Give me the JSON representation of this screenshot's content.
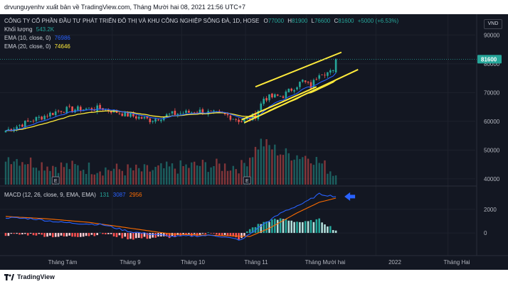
{
  "header": {
    "publisher_text": "drvunguyenhv xuất bản về TradingView.com, Tháng Mười hai 08, 2021 21:56 UTC+7"
  },
  "legend": {
    "symbol_line": "CÔNG TY CỔ PHẦN ĐẦU TƯ PHÁT TRIỂN ĐÔ THỊ VÀ KHU CÔNG NGHIỆP SÔNG ĐÀ, 1D, HOSE",
    "ohlc": {
      "o_label": "O",
      "o": "77000",
      "h_label": "H",
      "h": "81900",
      "l_label": "L",
      "l": "76600",
      "c_label": "C",
      "c": "81600",
      "change": "+5000 (+6.53%)"
    },
    "volume_label": "Khối lượng",
    "volume_value": "543.2K",
    "ema10_label": "EMA (10, close, 0)",
    "ema10_value": "76986",
    "ema20_label": "EMA (20, close, 0)",
    "ema20_value": "74646",
    "macd_label": "MACD (12, 26, close, 9, EMA, EMA)",
    "macd_hist": "131",
    "macd_line": "3087",
    "macd_signal": "2956",
    "currency": "VND"
  },
  "price_axis": {
    "ticks": [
      "90000",
      "80000",
      "70000",
      "60000",
      "50000",
      "40000"
    ],
    "last_price_label": "81600"
  },
  "macd_axis": {
    "ticks": [
      "2000",
      "0"
    ]
  },
  "time_axis": {
    "labels": [
      "Tháng Tám",
      "Tháng 9",
      "Tháng 10",
      "Tháng 11",
      "Tháng Mười hai",
      "2022",
      "Tháng Hai"
    ]
  },
  "earnings_marker": "E",
  "footer": {
    "brand": "TradingView"
  },
  "colors": {
    "background": "#131722",
    "up": "#26a69a",
    "down": "#ef5350",
    "ema10": "#2962ff",
    "ema20": "#ffeb3b",
    "macd_line": "#2962ff",
    "signal_line": "#ff6d00",
    "channel": "#ffeb3b",
    "arrow": "#2962ff"
  },
  "chart_data": {
    "type": "candlestick",
    "instrument": "CÔNG TY CỔ PHẦN ĐẦU TƯ PHÁT TRIỂN ĐÔ THỊ VÀ KHU CÔNG NGHIỆP SÔNG ĐÀ",
    "interval": "1D",
    "exchange": "HOSE",
    "price_range": [
      38000,
      96000
    ],
    "last_bar": {
      "open": 77000,
      "high": 81900,
      "low": 76600,
      "close": 81600
    },
    "anchors": [
      {
        "bar": 0,
        "close": 56800
      },
      {
        "bar": 10,
        "close": 60500
      },
      {
        "bar": 20,
        "close": 64000
      },
      {
        "bar": 35,
        "close": 64500
      },
      {
        "bar": 45,
        "close": 62000
      },
      {
        "bar": 52,
        "close": 60500
      },
      {
        "bar": 60,
        "close": 62500
      },
      {
        "bar": 70,
        "close": 63500
      },
      {
        "bar": 80,
        "close": 62000
      },
      {
        "bar": 85,
        "close": 60000
      },
      {
        "bar": 90,
        "close": 62000
      },
      {
        "bar": 93,
        "close": 68000
      },
      {
        "bar": 100,
        "close": 69000
      },
      {
        "bar": 107,
        "close": 74000
      },
      {
        "bar": 110,
        "close": 72000
      },
      {
        "bar": 113,
        "close": 77000
      },
      {
        "bar": 118,
        "close": 77000
      },
      {
        "bar": 119,
        "close": 81600
      }
    ],
    "volume_anchors": [
      {
        "bar": 0,
        "value": 47000
      },
      {
        "bar": 15,
        "value": 44000
      },
      {
        "bar": 30,
        "value": 43000
      },
      {
        "bar": 50,
        "value": 42000
      },
      {
        "bar": 70,
        "value": 44000
      },
      {
        "bar": 85,
        "value": 43500
      },
      {
        "bar": 92,
        "value": 52000
      },
      {
        "bar": 100,
        "value": 48000
      },
      {
        "bar": 110,
        "value": 47000
      },
      {
        "bar": 119,
        "value": 41000
      }
    ],
    "macd_anchors": [
      {
        "bar": 0,
        "value": 1300
      },
      {
        "bar": 10,
        "value": 1200
      },
      {
        "bar": 20,
        "value": 900
      },
      {
        "bar": 35,
        "value": 700
      },
      {
        "bar": 45,
        "value": 100
      },
      {
        "bar": 60,
        "value": -300
      },
      {
        "bar": 75,
        "value": -200
      },
      {
        "bar": 85,
        "value": -600
      },
      {
        "bar": 92,
        "value": 600
      },
      {
        "bar": 100,
        "value": 1800
      },
      {
        "bar": 108,
        "value": 2600
      },
      {
        "bar": 113,
        "value": 3300
      },
      {
        "bar": 119,
        "value": 3087
      }
    ],
    "signal_anchors": [
      {
        "bar": 0,
        "value": 1400
      },
      {
        "bar": 15,
        "value": 1200
      },
      {
        "bar": 30,
        "value": 900
      },
      {
        "bar": 45,
        "value": 400
      },
      {
        "bar": 60,
        "value": -100
      },
      {
        "bar": 75,
        "value": -200
      },
      {
        "bar": 88,
        "value": -300
      },
      {
        "bar": 95,
        "value": 400
      },
      {
        "bar": 105,
        "value": 1700
      },
      {
        "bar": 113,
        "value": 2600
      },
      {
        "bar": 119,
        "value": 2956
      }
    ],
    "macd_range": [
      -1500,
      3800
    ],
    "channel_lines": [
      {
        "from": {
          "bar": 90,
          "price": 72000
        },
        "to": {
          "bar": 121,
          "price": 84000
        }
      },
      {
        "from": {
          "bar": 86,
          "price": 59500
        },
        "to": {
          "bar": 127,
          "price": 78000
        }
      },
      {
        "from": {
          "bar": 85,
          "price": 60500
        },
        "to": {
          "bar": 112,
          "price": 72000
        }
      }
    ]
  }
}
